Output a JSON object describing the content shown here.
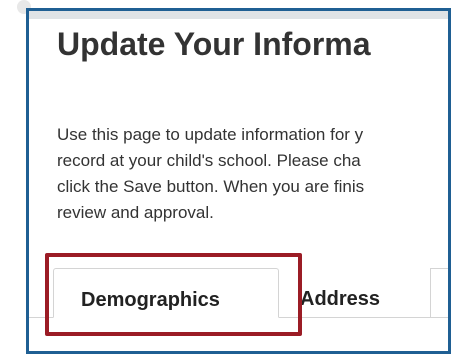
{
  "page": {
    "title": "Update Your Informa",
    "instructions": [
      "Use this page to update information for y",
      "record at your child's school. Please cha",
      "click the Save button. When you are finis",
      "review and approval."
    ]
  },
  "tabs": [
    {
      "label": "Demographics",
      "selected": true
    },
    {
      "label": "Address",
      "selected": false
    }
  ],
  "colors": {
    "frame_border": "#1f5f93",
    "highlight_border": "#9b1c25",
    "text": "#333333"
  }
}
